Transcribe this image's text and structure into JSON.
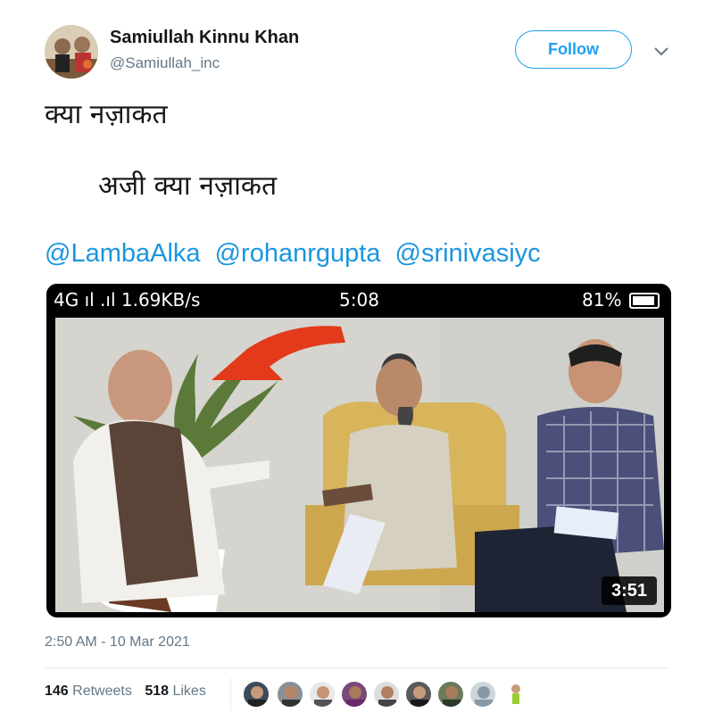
{
  "author": {
    "name": "Samiullah Kinnu Khan",
    "handle": "@Samiullah_inc",
    "follow_label": "Follow"
  },
  "tweet": {
    "line1": "क्या नज़ाकत",
    "line2": "अजी क्या नज़ाकत",
    "mentions": [
      "@LambaAlka",
      "@rohanrgupta",
      "@srinivasiyc"
    ],
    "timestamp": "2:50 AM - 10 Mar 2021"
  },
  "media": {
    "status_signal": "4G ıl .ıl 1.69KB/s",
    "status_time": "5:08",
    "status_battery": "81%",
    "video_duration": "3:51"
  },
  "stats": {
    "retweets_count": "146",
    "retweets_label": "Retweets",
    "likes_count": "518",
    "likes_label": "Likes"
  },
  "colors": {
    "accent": "#1da1f2",
    "link": "#1b95e0",
    "secondary_text": "#657786"
  }
}
